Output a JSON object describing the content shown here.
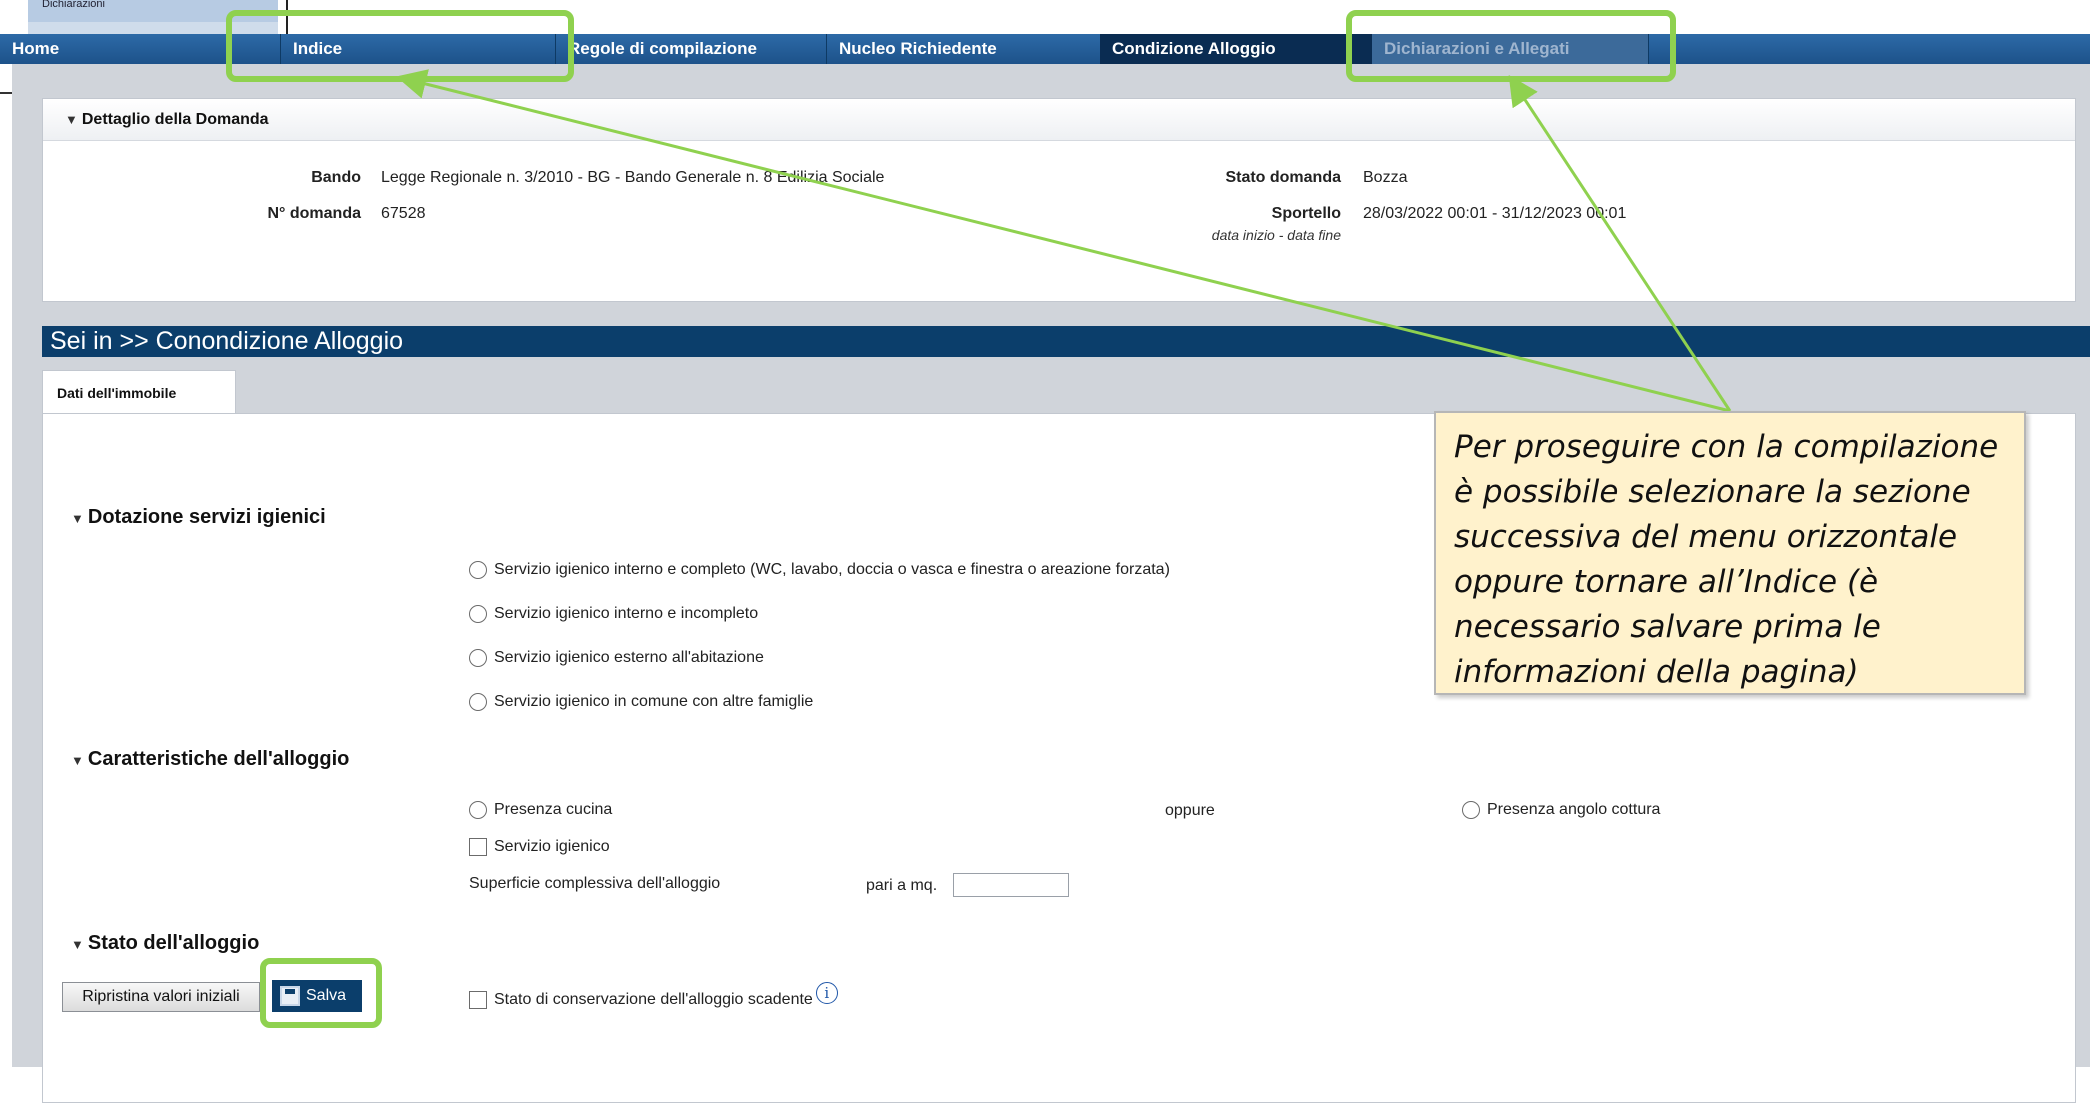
{
  "top": {
    "crumb_label": "Dichiarazioni"
  },
  "nav": {
    "home": "Home",
    "indice": "Indice",
    "regole": "Regole di compilazione",
    "nucleo": "Nucleo Richiedente",
    "condizione": "Condizione Alloggio",
    "dichiarazioni": "Dichiarazioni e Allegati"
  },
  "detail": {
    "title": "Dettaglio della Domanda",
    "bando_label": "Bando",
    "bando_value": "Legge Regionale n. 3/2010 - BG - Bando Generale n. 8 Edilizia Sociale",
    "numero_label": "N° domanda",
    "numero_value": "67528",
    "stato_label": "Stato domanda",
    "stato_value": "Bozza",
    "sportello_label": "Sportello",
    "sportello_value": "28/03/2022 00:01 - 31/12/2023 00:01",
    "sportello_sub": "data inizio - data fine"
  },
  "breadcrumb": "Sei in >> Conondizione Alloggio",
  "tab": "Dati dell'immobile",
  "sections": {
    "servizi": {
      "title": "Dotazione servizi igienici",
      "options": [
        "Servizio igienico interno e completo (WC, lavabo, doccia o vasca e finestra o areazione forzata)",
        "Servizio igienico interno e incompleto",
        "Servizio igienico esterno all'abitazione",
        "Servizio igienico in comune con altre famiglie"
      ]
    },
    "caratteristiche": {
      "title": "Caratteristiche dell'alloggio",
      "cucina": "Presenza cucina",
      "oppure": "oppure",
      "angolo": "Presenza angolo cottura",
      "servizio": "Servizio igienico",
      "superficie": "Superficie complessiva dell'alloggio",
      "pari": "pari a mq.",
      "superficie_value": ""
    },
    "stato": {
      "title": "Stato dell'alloggio",
      "conservazione": "Stato di conservazione dell'alloggio scadente"
    }
  },
  "buttons": {
    "reset": "Ripristina valori iniziali",
    "save": "Salva"
  },
  "callout": "Per proseguire con la compilazione è possibile selezionare la sezione successiva del menu orizzontale oppure tornare all’Indice (è necessario salvare prima le informazioni della pagina)",
  "colors": {
    "nav": "#1d528a",
    "active": "#0a2c52",
    "highlight": "#8fd14f",
    "callout_bg": "#fff2cc"
  }
}
